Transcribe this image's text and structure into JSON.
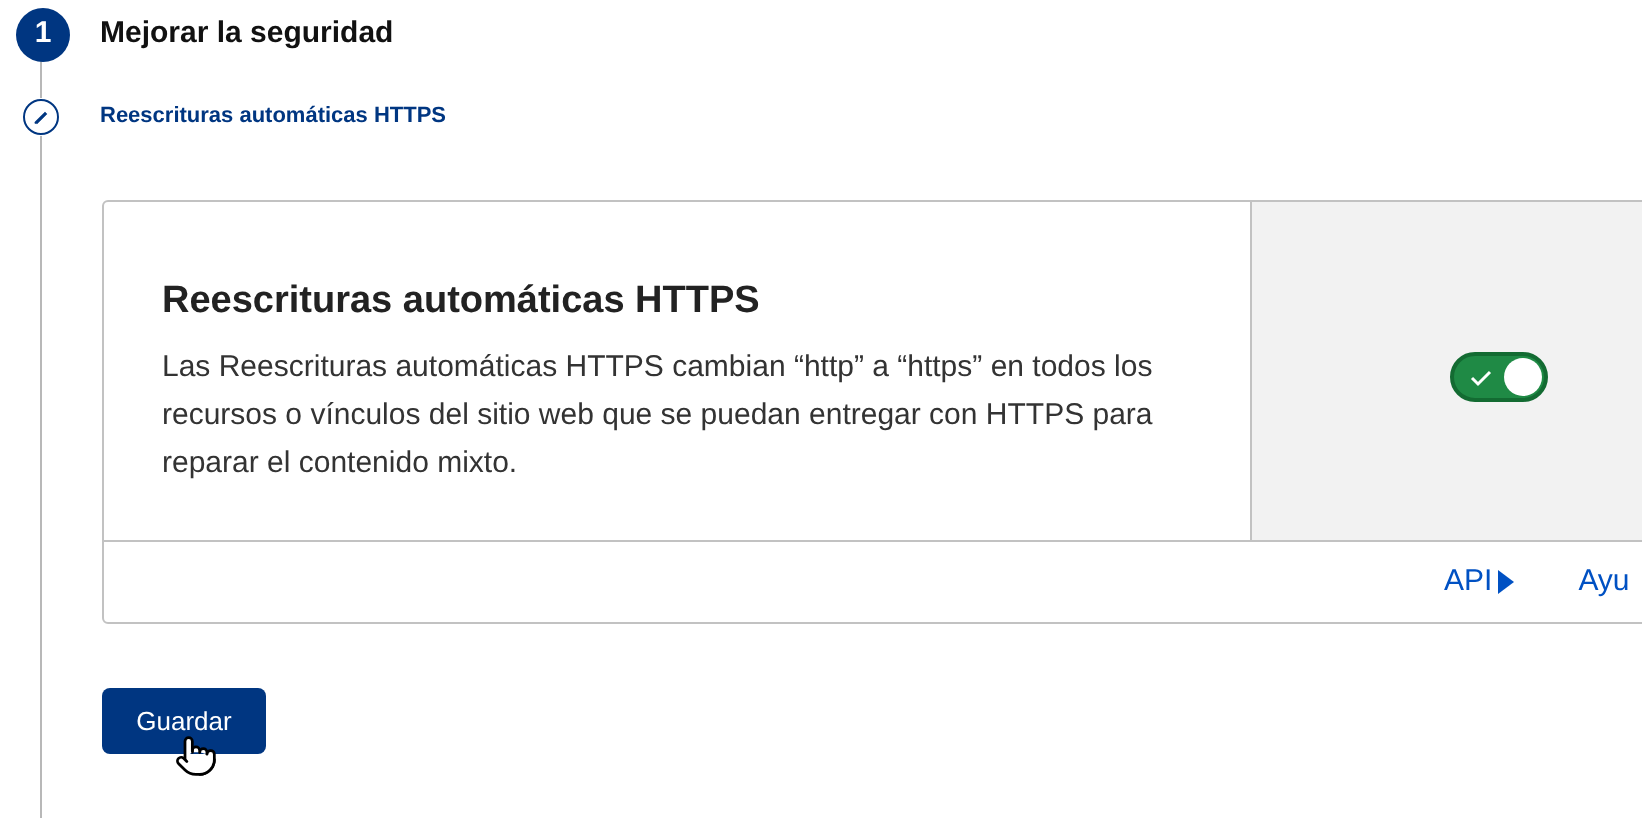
{
  "step": {
    "number": "1",
    "title": "Mejorar la seguridad"
  },
  "substep": {
    "title": "Reescrituras automáticas HTTPS"
  },
  "card": {
    "title": "Reescrituras automáticas HTTPS",
    "description": "Las Reescrituras automáticas HTTPS cambian “http” a “https” en todos los recursos o vínculos del sitio web que se puedan entregar con HTTPS para reparar el contenido mixto.",
    "toggle": {
      "on": true
    },
    "links": [
      {
        "label": "API",
        "arrow": true
      },
      {
        "label": "Ayu",
        "arrow": false
      }
    ]
  },
  "save_button": {
    "label": "Guardar"
  }
}
